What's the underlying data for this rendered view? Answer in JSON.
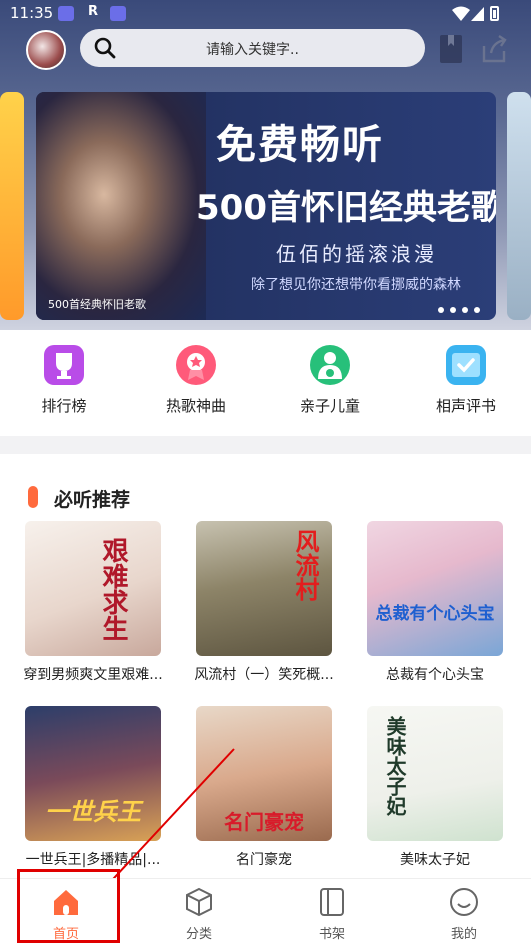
{
  "statusbar": {
    "time": "11:35",
    "r_glyph": "R"
  },
  "search": {
    "placeholder": "请输入关键字.."
  },
  "banner": {
    "line1": "免费畅听",
    "line2": "500首怀旧经典老歌",
    "line3": "伍佰的摇滚浪漫",
    "line4": "除了想见你还想带你看挪威的森林",
    "caption": "500首经典怀旧老歌"
  },
  "quick": [
    {
      "label": "排行榜",
      "icon": "trophy-icon",
      "color": "#b94ce8"
    },
    {
      "label": "热歌神曲",
      "icon": "medal-icon",
      "color": "#ff5a7a"
    },
    {
      "label": "亲子儿童",
      "icon": "family-icon",
      "color": "#27c07a"
    },
    {
      "label": "相声评书",
      "icon": "book-check-icon",
      "color": "#3ab3f0"
    }
  ],
  "section": {
    "title": "必听推荐"
  },
  "books": [
    {
      "title": "穿到男频爽文里艰难...",
      "cover_text": "艰难求生"
    },
    {
      "title": "风流村（一）笑死概...",
      "cover_text": "风流村"
    },
    {
      "title": "总裁有个心头宝",
      "cover_text": "总裁有个心头宝"
    },
    {
      "title": "一世兵王|多播精品|...",
      "cover_text": "一世兵王"
    },
    {
      "title": "名门豪宠",
      "cover_text": "名门豪宠"
    },
    {
      "title": "美味太子妃",
      "cover_text": "美味太子妃"
    }
  ],
  "tabs": [
    {
      "label": "首页",
      "icon": "home-icon",
      "active": true
    },
    {
      "label": "分类",
      "icon": "category-cube-icon",
      "active": false
    },
    {
      "label": "书架",
      "icon": "bookshelf-icon",
      "active": false
    },
    {
      "label": "我的",
      "icon": "profile-smile-icon",
      "active": false
    }
  ],
  "colors": {
    "accent": "#ff6a3d",
    "highlight": "#e00000"
  }
}
